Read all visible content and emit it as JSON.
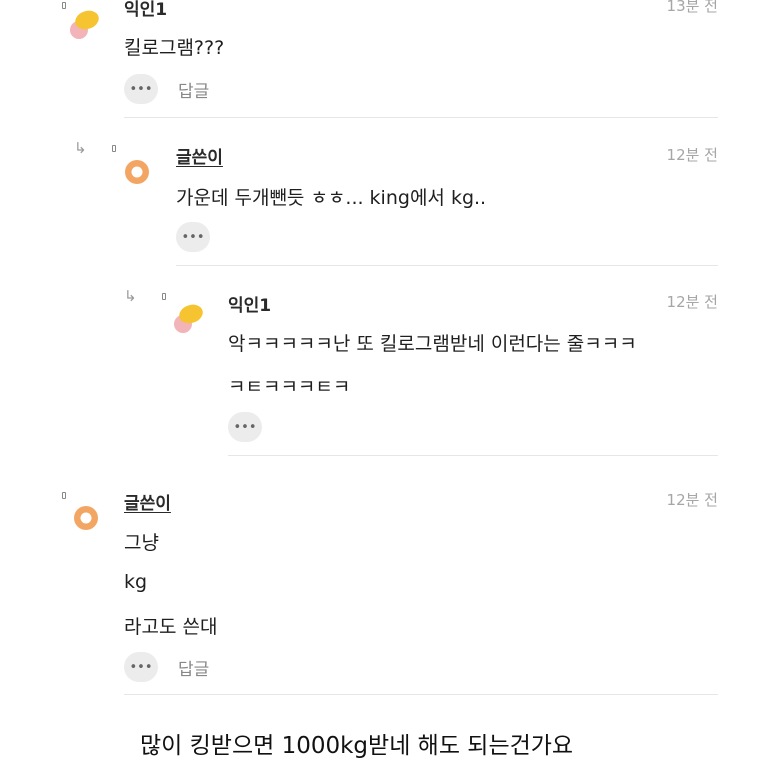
{
  "comments": [
    {
      "author": "익인1",
      "time": "13분 전",
      "lines": [
        "킬로그램???"
      ],
      "more_label": "•••",
      "reply_label": "답글"
    },
    {
      "author": "글쓴이",
      "time": "12분 전",
      "lines": [
        "가운데 두개뺀듯 ㅎㅎ... king에서 kg.."
      ],
      "more_label": "•••"
    },
    {
      "author": "익인1",
      "time": "12분 전",
      "lines": [
        "악ㅋㅋㅋㅋㅋ난 또 킬로그램받네 이런다는 줄ㅋㅋㅋ",
        "ㅋㅌㅋㅋㅋㅌㅋ"
      ],
      "more_label": "•••"
    },
    {
      "author": "글쓴이",
      "time": "12분 전",
      "lines": [
        "그냥",
        "kg",
        "라고도 쓴대"
      ],
      "more_label": "•••",
      "reply_label": "답글"
    }
  ],
  "reply_arrow": "↳",
  "caption": "많이 킹받으면 1000kg받네 해도 되는건가요",
  "colors": {
    "avatar_yellow": "#f6c431",
    "avatar_pink": "#f2b4b8",
    "avatar_orange": "#f3a664",
    "divider": "#e6e6e6",
    "timestamp": "#a6a6a6"
  }
}
